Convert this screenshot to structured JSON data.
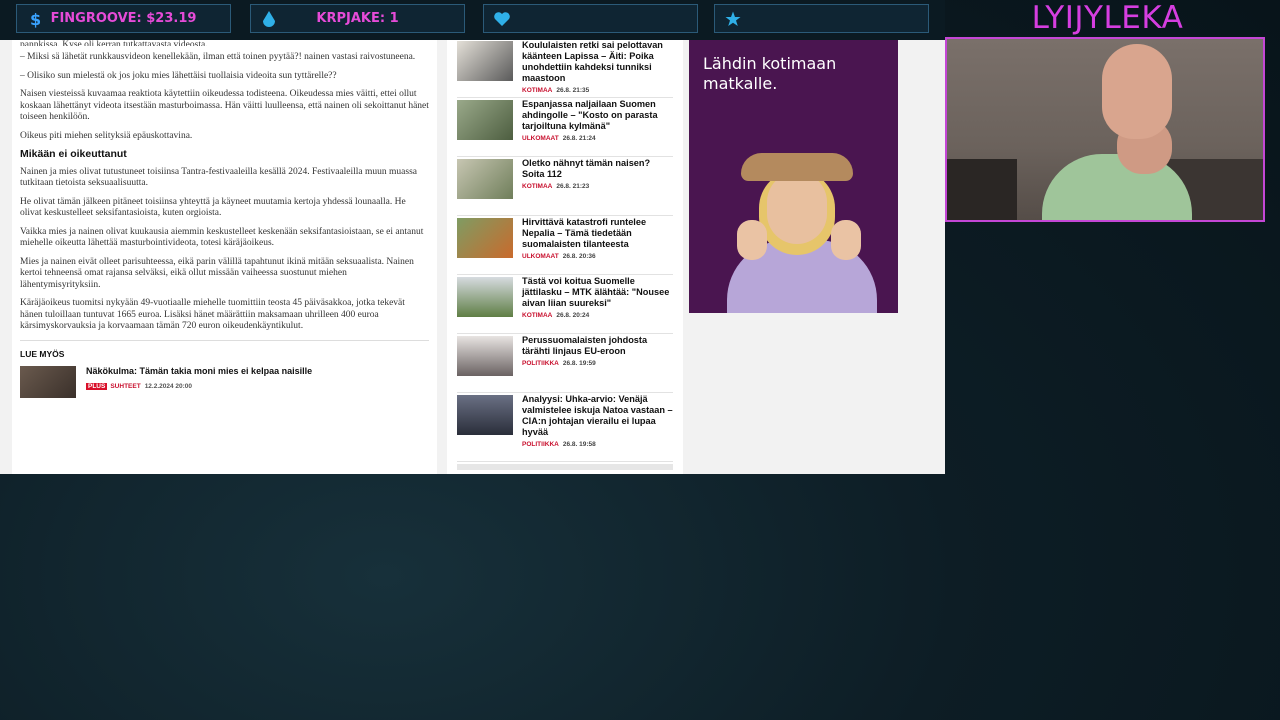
{
  "overlay": {
    "stats": [
      {
        "icon": "dollar-icon",
        "value": "FINGROOVE: $23.19"
      },
      {
        "icon": "droplet-icon",
        "value": "KRPJAKE: 1"
      },
      {
        "icon": "heart-icon",
        "value": ""
      },
      {
        "icon": "star-icon",
        "value": ""
      }
    ],
    "streamer_name": "LYIJYLEKA",
    "accent": "#d63ee0"
  },
  "article": {
    "cut_line": "pannkissa. Kyse oli kerran tutkattavasta videosta.",
    "paragraphs_top": [
      "– Miksi sä lähetät runkkausvideon kenellekään, ilman että toinen pyytää?! nainen vastasi raivostuneena.",
      "– Olisiko sun mielestä ok jos joku mies lähettäisi tuollaisia videoita sun tyttärelle??",
      "Naisen viesteissä kuvaamaa reaktiota käytettiin oikeudessa todisteena. Oikeudessa mies väitti, ettei ollut koskaan lähettänyt videota itsestään masturboimassa. Hän väitti luulleensa, että nainen oli sekoittanut hänet toiseen henkilöön.",
      "Oikeus piti miehen selityksiä epäuskottavina."
    ],
    "subheading": "Mikään ei oikeuttanut",
    "paragraphs_bottom": [
      "Nainen ja mies olivat tutustuneet toisiinsa Tantra-festivaaleilla kesällä 2024. Festivaaleilla muun muassa tutkitaan tietoista seksuaalisuutta.",
      "He olivat tämän jälkeen pitäneet toisiinsa yhteyttä ja käyneet muutamia kertoja yhdessä lounaalla. He olivat keskustelleet seksifantasioista, kuten orgioista.",
      "Vaikka mies ja nainen olivat kuukausia aiemmin keskustelleet keskenään seksifantasioistaan, se ei antanut miehelle oikeutta lähettää masturbointivideota, totesi käräjäoikeus.",
      "Mies ja nainen eivät olleet parisuhteessa, eikä parin välillä tapahtunut ikinä mitään seksuaalista. Nainen kertoi tehneensä omat rajansa selväksi, eikä ollut missään vaiheessa suostunut miehen lähentymisyrityksiin.",
      "Käräjäoikeus tuomitsi nykyään 49-vuotiaalle miehelle tuomittiin teosta 45 päiväsakkoa, jotka tekevät hänen tuloillaan tuntuvat 1665 euroa. Lisäksi hänet määrättiin maksamaan uhrilleen 400 euroa kärsimyskorvauksia ja korvaamaan tämän 720 euron oikeudenkäyntikulut."
    ],
    "read_more_label": "LUE MYÖS",
    "related": {
      "title": "Näkökulma: Tämän takia moni mies ei kelpaa naisille",
      "badge": "PLUS",
      "category": "SUHTEET",
      "date": "12.2.2024 20:00"
    }
  },
  "news": [
    {
      "title": "Koululaisten retki sai pelottavan käänteen Lapissa – Äiti: Poika unohdettiin kahdeksi tunniksi maastoon",
      "category": "KOTIMAA",
      "date": "26.8. 21:35",
      "thumb_color": "#cfcac2"
    },
    {
      "title": "Espanjassa naljailaan Suomen ahdingolle – \"Kosto on parasta tarjoiltuna kylmänä\"",
      "category": "ULKOMAAT",
      "date": "26.8. 21:24",
      "thumb_color": "#7f8c6e"
    },
    {
      "title": "Oletko nähnyt tämän naisen? Soita 112",
      "category": "KOTIMAA",
      "date": "26.8. 21:23",
      "thumb_color": "#a6a88e"
    },
    {
      "title": "Hirvittävä katastrofi runtelee Nepalia – Tämä tiedetään suomalaisten tilanteesta",
      "category": "ULKOMAAT",
      "date": "26.8. 20:36",
      "thumb_color": "#5d7a4a"
    },
    {
      "title": "Tästä voi koitua Suomelle jättilasku – MTK älähtää: \"Nousee aivan liian suureksi\"",
      "category": "KOTIMAA",
      "date": "26.8. 20:24",
      "thumb_color": "#6f8a58"
    },
    {
      "title": "Perussuomalaisten johdosta tärähti linjaus EU-eroon",
      "category": "POLITIIKKA",
      "date": "26.8. 19:59",
      "thumb_color": "#8a7f80"
    },
    {
      "title": "Analyysi: Uhka-arvio: Venäjä valmistelee iskuja Natoa vastaan – CIA:n johtajan vierailu ei lupaa hyvää",
      "category": "POLITIIKKA",
      "date": "26.8. 19:58",
      "thumb_color": "#3a3f4e"
    }
  ],
  "ad": {
    "text": "Lähdin kotimaan matkalle."
  }
}
